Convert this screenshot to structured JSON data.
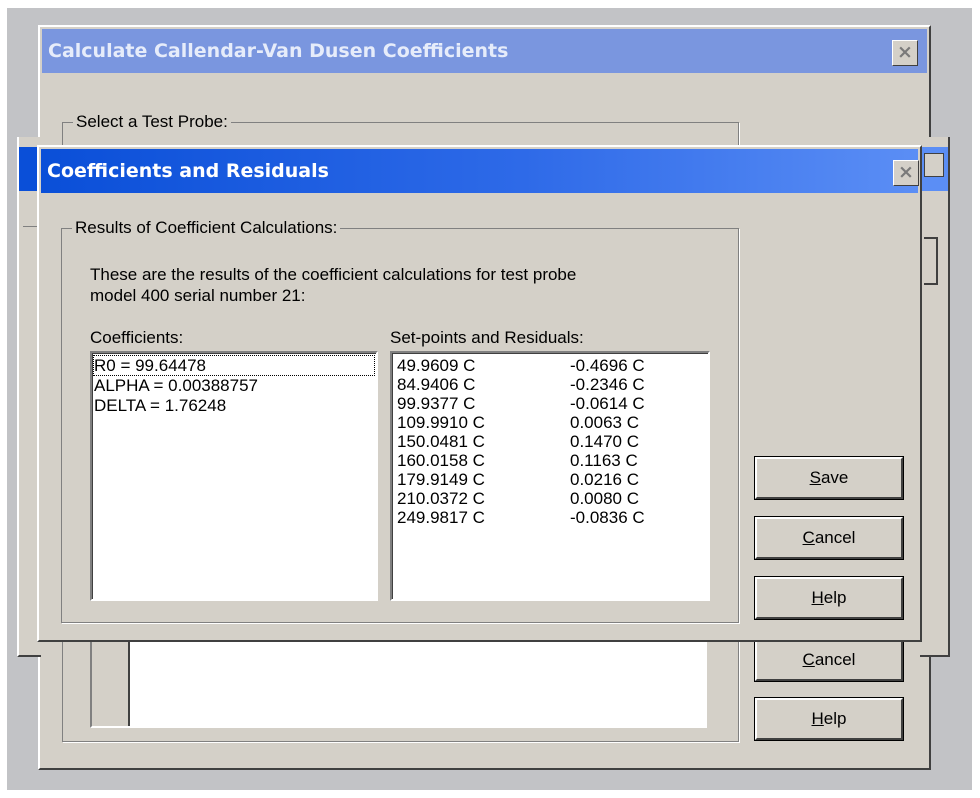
{
  "back_window": {
    "title": "Calculate Callendar-Van Dusen Coefficients",
    "group_label": "Select a Test Probe:",
    "buttons": {
      "cancel": "Cancel",
      "help": "Help"
    }
  },
  "dialog": {
    "title": "Coefficients and Residuals",
    "group_label": "Results of Coefficient Calculations:",
    "description_line1": "These are the results of the coefficient calculations for test probe",
    "description_line2": "model 400 serial number 21:",
    "coefficients_label": "Coefficients:",
    "coefficients": [
      "R0 = 99.64478",
      "ALPHA = 0.00388757",
      "DELTA = 1.76248"
    ],
    "residuals_label": "Set-points and Residuals:",
    "residuals": [
      {
        "setpoint": "49.9609 C",
        "residual": "-0.4696 C"
      },
      {
        "setpoint": "84.9406 C",
        "residual": "-0.2346 C"
      },
      {
        "setpoint": "99.9377 C",
        "residual": "-0.0614 C"
      },
      {
        "setpoint": "109.9910 C",
        "residual": "0.0063 C"
      },
      {
        "setpoint": "150.0481 C",
        "residual": "0.1470 C"
      },
      {
        "setpoint": "160.0158 C",
        "residual": "0.1163 C"
      },
      {
        "setpoint": "179.9149 C",
        "residual": "0.0216 C"
      },
      {
        "setpoint": "210.0372 C",
        "residual": "0.0080 C"
      },
      {
        "setpoint": "249.9817 C",
        "residual": "-0.0836 C"
      }
    ],
    "buttons": {
      "save": "Save",
      "cancel": "Cancel",
      "help": "Help"
    }
  },
  "colors": {
    "inactive_title": "#7a96df",
    "active_title_start": "#0a4fd8",
    "active_title_end": "#5b8ef5",
    "face": "#d4d0c8"
  }
}
